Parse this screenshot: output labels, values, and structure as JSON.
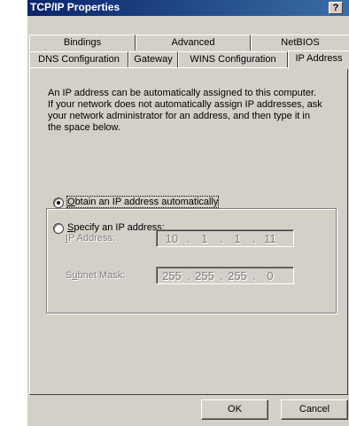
{
  "window": {
    "title": "TCP/IP Properties",
    "help_label": "?"
  },
  "tabs": {
    "back_row": [
      "Bindings",
      "Advanced",
      "NetBIOS"
    ],
    "front_row": [
      "DNS Configuration",
      "Gateway",
      "WINS Configuration",
      "IP Address"
    ],
    "active": "IP Address"
  },
  "panel": {
    "description": "An IP address can be automatically assigned to this computer.\nIf your network does not automatically assign IP addresses, ask\nyour network administrator for an address, and then type it in\nthe space below.",
    "option_obtain": {
      "label_accel": "O",
      "label_rest": "btain an IP address automatically",
      "selected": true
    },
    "option_specify": {
      "label_accel": "S",
      "label_rest": "pecify an IP address:",
      "selected": false
    },
    "ip_address": {
      "label_accel": "I",
      "label_rest": "P Address:",
      "octets": [
        "10",
        "1",
        "1",
        "11"
      ]
    },
    "subnet_mask": {
      "label_pre": "S",
      "label_accel": "u",
      "label_rest": "bnet Mask:",
      "octets": [
        "255",
        "255",
        "255",
        "0"
      ]
    }
  },
  "buttons": {
    "ok": "OK",
    "cancel": "Cancel"
  }
}
